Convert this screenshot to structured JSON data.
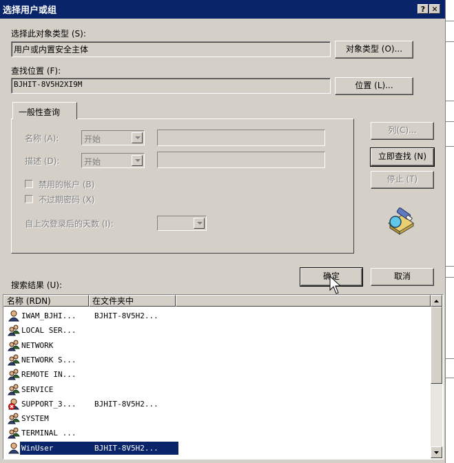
{
  "window": {
    "title": "选择用户或组",
    "help_label": "?",
    "close_label": "✕"
  },
  "object_type": {
    "label": "选择此对象类型",
    "hotkey": "(S):",
    "value": "用户或内置安全主体",
    "button": "对象类型 (O)..."
  },
  "location": {
    "label": "查找位置",
    "hotkey": "(F):",
    "value": "BJHIT-8V5H2XI9M",
    "button": "位置 (L)..."
  },
  "tab": {
    "label": "一般性查询"
  },
  "query": {
    "name_label": "名称 (A):",
    "name_mode": "开始",
    "desc_label": "描述 (D):",
    "desc_mode": "开始",
    "disabled_accounts": "禁用的帐户 (B)",
    "non_expiring_pwd": "不过期密码 (X)",
    "days_label": "自上次登录后的天数 (I):"
  },
  "side_buttons": {
    "columns": "列(C)...",
    "find_now": "立即查找 (N)",
    "stop": "停止 (T)"
  },
  "results": {
    "label": "搜索结果 (U):",
    "ok": "确定",
    "cancel": "取消",
    "col_name": "名称 (RDN)",
    "col_folder": "在文件夹中",
    "rows": [
      {
        "name": "IWAM_BJHI...",
        "folder": "BJHIT-8V5H2...",
        "icon": "user-icon"
      },
      {
        "name": "LOCAL SER...",
        "folder": "",
        "icon": "group-icon"
      },
      {
        "name": "NETWORK",
        "folder": "",
        "icon": "group-icon"
      },
      {
        "name": "NETWORK S...",
        "folder": "",
        "icon": "group-icon"
      },
      {
        "name": "REMOTE IN...",
        "folder": "",
        "icon": "group-icon"
      },
      {
        "name": "SERVICE",
        "folder": "",
        "icon": "group-icon"
      },
      {
        "name": "SUPPORT_3...",
        "folder": "BJHIT-8V5H2...",
        "icon": "disabled-user-icon"
      },
      {
        "name": "SYSTEM",
        "folder": "",
        "icon": "group-icon"
      },
      {
        "name": "TERMINAL ...",
        "folder": "",
        "icon": "group-icon"
      },
      {
        "name": "WinUser",
        "folder": "BJHIT-8V5H2...",
        "icon": "user-icon",
        "selected": true
      }
    ]
  },
  "colors": {
    "title_bar": "#0a246a",
    "face": "#d4d0c8",
    "selection": "#0a246a"
  }
}
